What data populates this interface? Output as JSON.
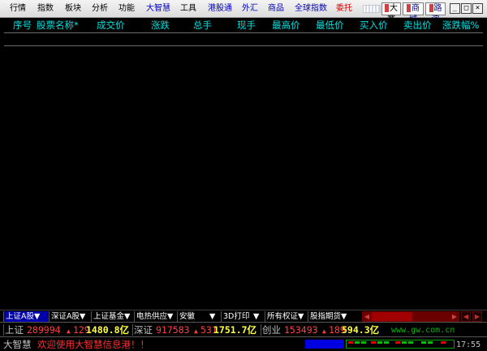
{
  "menu": {
    "items": [
      "行情",
      "指数",
      "板块",
      "分析",
      "功能",
      "大智慧",
      "工具",
      "港股通",
      "外汇",
      "商品",
      "全球指数",
      "委托"
    ],
    "toolbar_buttons": [
      "大赛",
      "商城",
      "路演"
    ],
    "window_controls": [
      "_",
      "□",
      "×"
    ]
  },
  "columns": [
    "序号",
    "股票名称*",
    "成交价",
    "涨跌",
    "总手",
    "现手",
    "最高价",
    "最低价",
    "买入价",
    "卖出价",
    "涨跌幅%"
  ],
  "tabs": [
    "上证A股▼",
    "深证A股▼",
    "上证基金▼",
    "电热供应▼",
    "安徽",
    "▼",
    "3D打印",
    "▼",
    "所有权证▼",
    "股指期货▼"
  ],
  "tabs_nav": [
    "◀",
    "▶",
    "◀",
    "▶"
  ],
  "ticker": {
    "sh_label": "上证",
    "sh_value": "289994",
    "sh_change": "129",
    "sh_amount": "1480.8亿",
    "sz_label": "深证",
    "sz_value": "917583",
    "sz_change": "531",
    "sz_amount": "1751.7亿",
    "cy_label": "创业",
    "cy_value": "153493",
    "cy_change": "189",
    "cy_amount": "594.3亿",
    "website": "www.gw.com.cn"
  },
  "status": {
    "app_label": "大智慧",
    "message": "欢迎使用大智慧信息港！！",
    "time": "17:55"
  },
  "colors": {
    "header_text": "#00e0e0",
    "up_red": "#ff4040",
    "amount_yellow": "#ffff40",
    "active_tab": "#0000a8"
  }
}
